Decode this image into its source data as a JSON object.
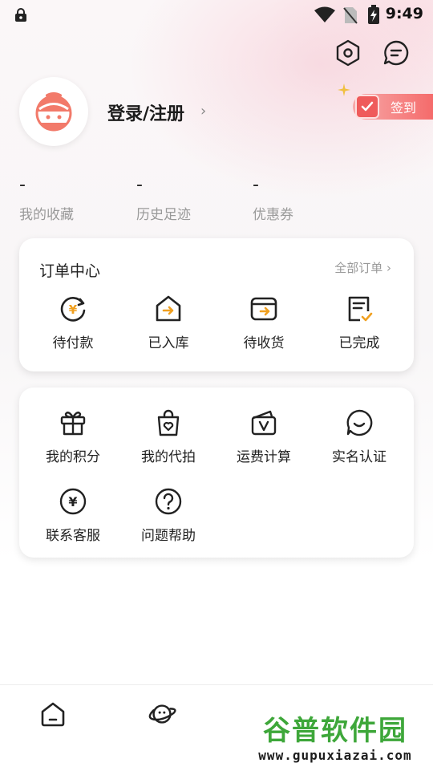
{
  "status_bar": {
    "time": "9:49",
    "icons": [
      "lock-icon",
      "wifi-icon",
      "no-sim-icon",
      "battery-charging-icon"
    ]
  },
  "header": {
    "settings_icon": "settings-hex-icon",
    "message_icon": "message-icon"
  },
  "profile": {
    "login_text": "登录/注册",
    "chevron": "›",
    "checkin_label": "签到"
  },
  "stats": [
    {
      "value": "-",
      "label": "我的收藏"
    },
    {
      "value": "-",
      "label": "历史足迹"
    },
    {
      "value": "-",
      "label": "优惠券"
    }
  ],
  "orders": {
    "title": "订单中心",
    "all_orders": "全部订单 ›",
    "items": [
      {
        "label": "待付款",
        "icon": "pay-icon"
      },
      {
        "label": "已入库",
        "icon": "warehouse-icon"
      },
      {
        "label": "待收货",
        "icon": "receive-icon"
      },
      {
        "label": "已完成",
        "icon": "completed-icon"
      }
    ]
  },
  "services": {
    "items": [
      {
        "label": "我的积分",
        "icon": "gift-icon"
      },
      {
        "label": "我的代拍",
        "icon": "bag-heart-icon"
      },
      {
        "label": "运费计算",
        "icon": "wallet-v-icon"
      },
      {
        "label": "实名认证",
        "icon": "smile-chat-icon"
      },
      {
        "label": "联系客服",
        "icon": "yen-circle-icon"
      },
      {
        "label": "问题帮助",
        "icon": "help-icon"
      }
    ]
  },
  "tabbar": {
    "items": [
      "home-icon",
      "planet-icon"
    ]
  },
  "watermark": {
    "title": "谷普软件园",
    "url": "www.gupuxiazai.com"
  },
  "colors": {
    "accent": "#f0a020",
    "checkin": "#f56b6b"
  }
}
